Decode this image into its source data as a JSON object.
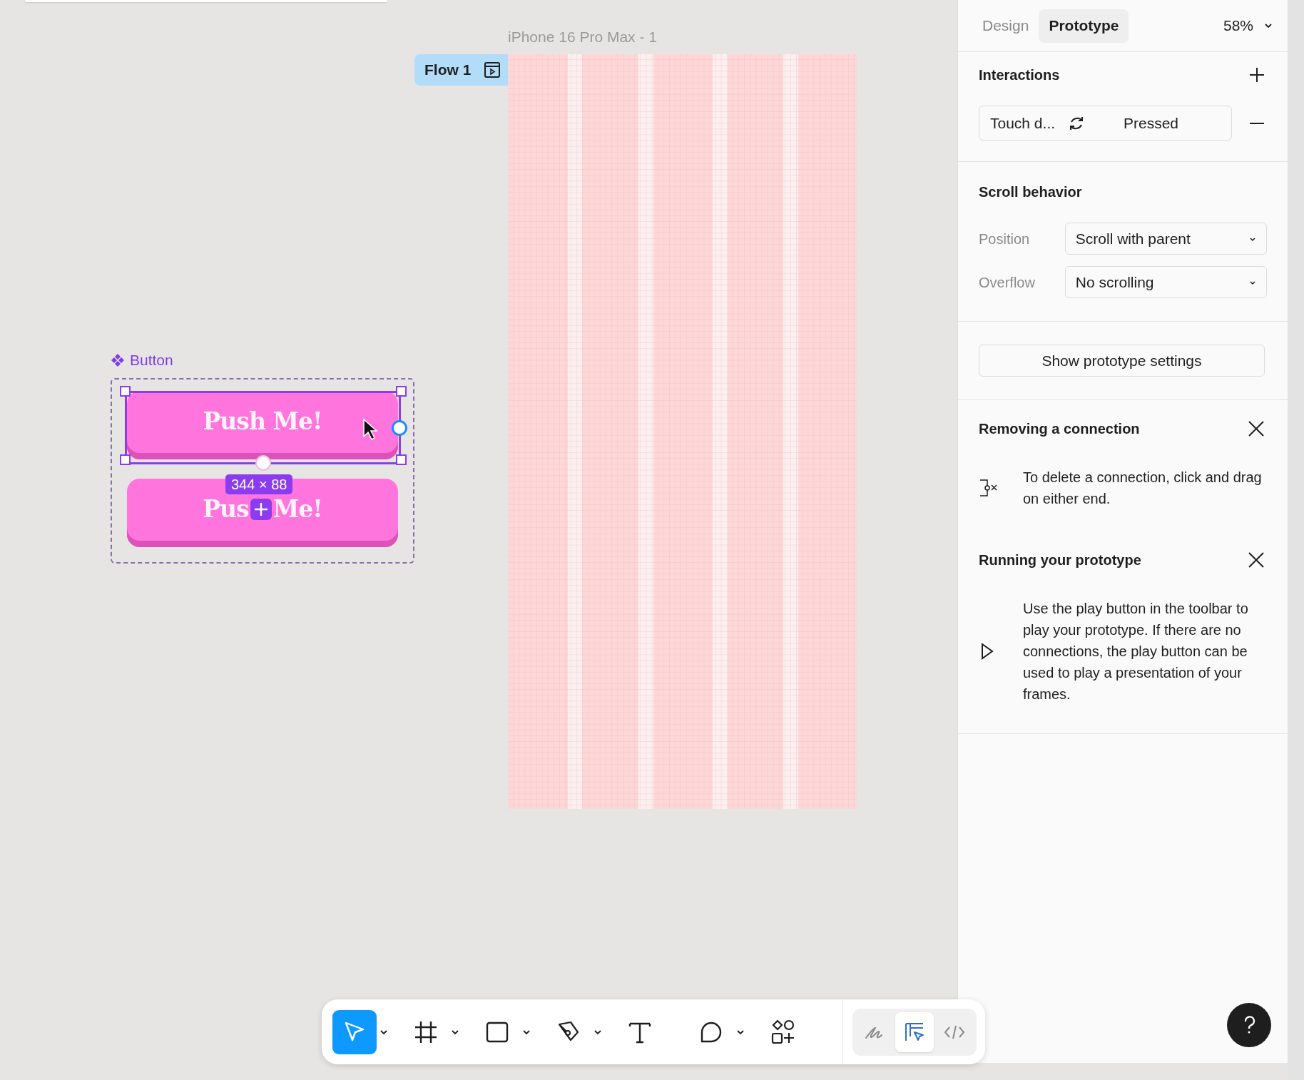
{
  "canvas": {
    "frame": {
      "title": "iPhone 16 Pro Max - 1"
    },
    "flow": {
      "label": "Flow 1"
    },
    "component": {
      "label": "Button",
      "size_badge": "344 × 88",
      "variants": [
        {
          "label_parts": [
            "Push Me!"
          ],
          "selected": true
        },
        {
          "label_parts": [
            "Pus",
            "Me!"
          ],
          "selected": false
        }
      ]
    }
  },
  "panel": {
    "tabs": [
      {
        "label": "Design",
        "selected": false
      },
      {
        "label": "Prototype",
        "selected": true
      }
    ],
    "zoom": "58%",
    "interactions": {
      "title": "Interactions",
      "items": [
        {
          "trigger": "Touch d...",
          "action": "Pressed"
        }
      ]
    },
    "scroll_behavior": {
      "title": "Scroll behavior",
      "fields": [
        {
          "label": "Position",
          "value": "Scroll with parent"
        },
        {
          "label": "Overflow",
          "value": "No scrolling"
        }
      ]
    },
    "settings_button": "Show prototype settings",
    "tips": [
      {
        "kind": "connection",
        "title": "Removing a connection",
        "text": "To delete a connection, click and drag on either end."
      },
      {
        "kind": "play",
        "title": "Running your prototype",
        "text": "Use the play button in the toolbar to play your prototype. If there are no connections, the play button can be used to play a presentation of your frames."
      }
    ]
  },
  "toolbar": {
    "tools": [
      {
        "kind": "move",
        "selected": true,
        "menu": true
      },
      {
        "kind": "frame",
        "selected": false,
        "menu": true
      },
      {
        "kind": "rectangle",
        "selected": false,
        "menu": true
      },
      {
        "kind": "pen",
        "selected": false,
        "menu": true
      },
      {
        "kind": "text",
        "selected": false,
        "menu": false
      },
      {
        "kind": "comment",
        "selected": false,
        "menu": true
      },
      {
        "kind": "components",
        "selected": false,
        "menu": false
      }
    ],
    "modes": [
      {
        "kind": "draw",
        "selected": false
      },
      {
        "kind": "prototype",
        "selected": true
      },
      {
        "kind": "dev",
        "selected": false
      }
    ]
  }
}
